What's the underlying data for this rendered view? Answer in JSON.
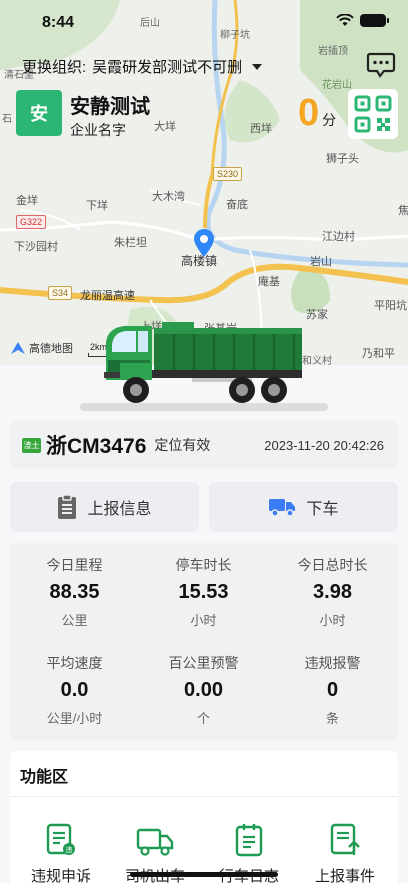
{
  "status_bar": {
    "time": "8:44"
  },
  "header": {
    "org_prefix": "更换组织:",
    "org_name": "吴霞研发部测试不可删"
  },
  "driver": {
    "avatar_text": "安",
    "name": "安静测试",
    "company": "企业名字",
    "score": "0",
    "score_unit": "分"
  },
  "map": {
    "labels": [
      "后山",
      "柳子坑",
      "岩插顶",
      "花岩山",
      "清石里",
      "石",
      "大垟",
      "西垟",
      "狮子头",
      "大木湾",
      "金垟",
      "下垟",
      "奋底",
      "江边村",
      "下沙园村",
      "朱栏坦",
      "高楼镇",
      "岩山",
      "龙丽温高速",
      "庵基",
      "平阳坑",
      "苏家",
      "上垟",
      "张基岩",
      "乃和平",
      "和义村",
      "焦"
    ],
    "roads": [
      "S230",
      "G322",
      "S34"
    ],
    "provider": "高德地图",
    "scale": "2km"
  },
  "vehicle": {
    "plate_badge": "渣土",
    "plate": "浙CM3476",
    "location_status": "定位有效",
    "location_time": "2023-11-20 20:42:26"
  },
  "actions": {
    "report_label": "上报信息",
    "exit_label": "下车"
  },
  "stats": [
    {
      "label": "今日里程",
      "value": "88.35",
      "unit": "公里"
    },
    {
      "label": "停车时长",
      "value": "15.53",
      "unit": "小时"
    },
    {
      "label": "今日总时长",
      "value": "3.98",
      "unit": "小时"
    },
    {
      "label": "平均速度",
      "value": "0.0",
      "unit": "公里/小时"
    },
    {
      "label": "百公里预警",
      "value": "0.00",
      "unit": "个"
    },
    {
      "label": "违规报警",
      "value": "0",
      "unit": "条"
    }
  ],
  "functions": {
    "title": "功能区",
    "items": [
      {
        "label": "违规申诉"
      },
      {
        "label": "司机出车"
      },
      {
        "label": "行车日志"
      },
      {
        "label": "上报事件"
      }
    ]
  },
  "colors": {
    "accent_green": "#2bb673",
    "score_orange": "#f5a623",
    "action_blue": "#3b7cf5"
  }
}
